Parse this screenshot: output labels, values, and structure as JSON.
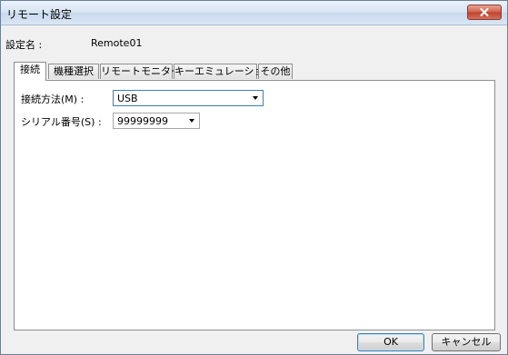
{
  "window": {
    "title": "リモート設定",
    "close_icon": "close-icon"
  },
  "setting": {
    "label": "設定名 :",
    "value": "Remote01"
  },
  "tabs": [
    {
      "label": "接続",
      "active": true
    },
    {
      "label": "機種選択",
      "active": false
    },
    {
      "label": "リモートモニター",
      "active": false
    },
    {
      "label": "キーエミュレーション",
      "active": false
    },
    {
      "label": "その他",
      "active": false
    }
  ],
  "connection": {
    "method_label": "接続方法(M) :",
    "method_value": "USB",
    "serial_label": "シリアル番号(S) :",
    "serial_value": "99999999"
  },
  "buttons": {
    "ok": "OK",
    "cancel": "キャンセル"
  }
}
